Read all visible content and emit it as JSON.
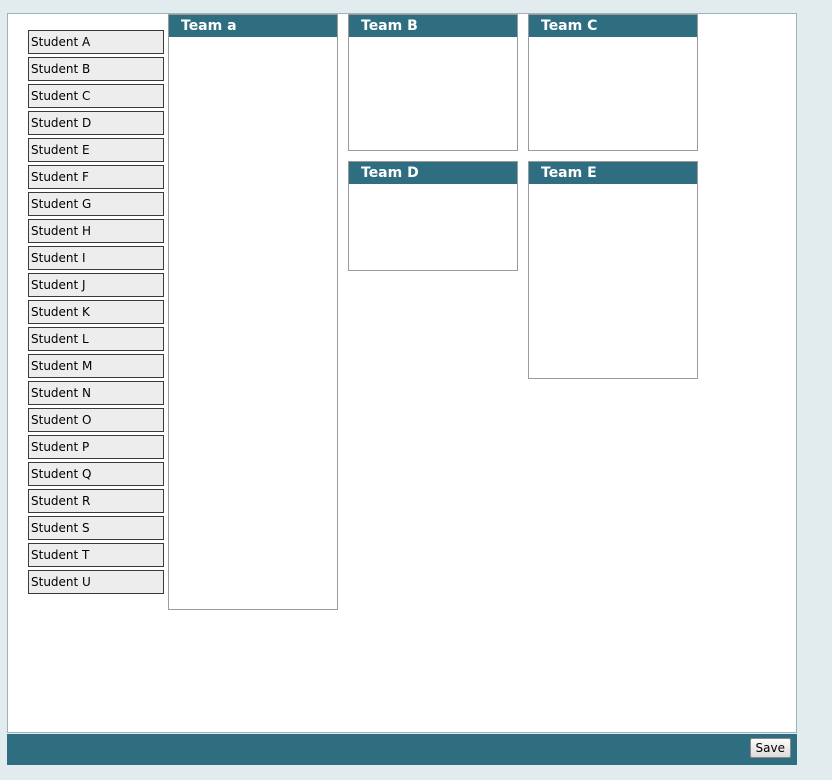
{
  "students": [
    "Student A",
    "Student B",
    "Student C",
    "Student D",
    "Student E",
    "Student F",
    "Student G",
    "Student H",
    "Student I",
    "Student J",
    "Student K",
    "Student L",
    "Student M",
    "Student N",
    "Student O",
    "Student P",
    "Student Q",
    "Student R",
    "Student S",
    "Student T",
    "Student U"
  ],
  "teams": {
    "a": {
      "name": "Team a"
    },
    "b": {
      "name": "Team B"
    },
    "c": {
      "name": "Team C"
    },
    "d": {
      "name": "Team D"
    },
    "e": {
      "name": "Team E"
    }
  },
  "footer": {
    "save_label": "Save"
  },
  "colors": {
    "accent": "#2f6e80",
    "page_background": "#e2ebee",
    "student_background": "#ededed"
  }
}
